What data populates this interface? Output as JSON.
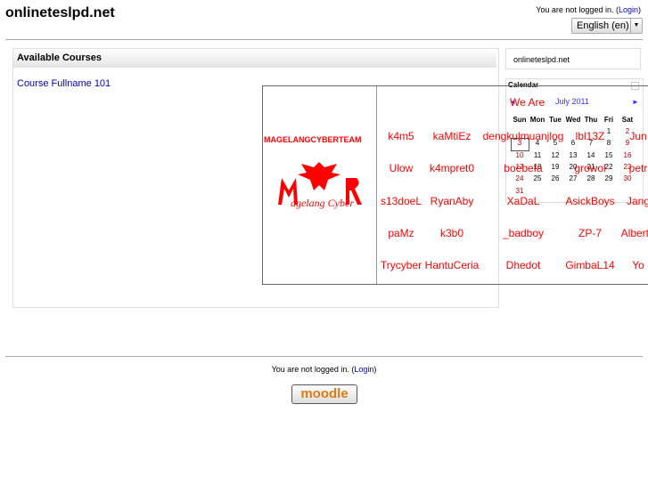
{
  "header": {
    "site_title": "onlineteslpd.net",
    "login_text": "You are not logged in. (",
    "login_link": "Login",
    "login_close": ")",
    "language": "English (en)"
  },
  "main": {
    "block_title": "Available Courses",
    "course": "Course Fullname 101"
  },
  "sidebar": {
    "site_name": "onlineteslpd.net",
    "calendar": {
      "title": "Calendar",
      "month": "July 2011",
      "prev": "◄",
      "next": "►",
      "days": [
        "Sun",
        "Mon",
        "Tue",
        "Wed",
        "Thu",
        "Fri",
        "Sat"
      ],
      "weeks": [
        [
          "",
          "",
          "",
          "",
          "",
          "1",
          "2"
        ],
        [
          "3",
          "4",
          "5",
          "6",
          "7",
          "8",
          "9"
        ],
        [
          "10",
          "11",
          "12",
          "13",
          "14",
          "15",
          "16"
        ],
        [
          "17",
          "18",
          "19",
          "20",
          "21",
          "22",
          "23"
        ],
        [
          "24",
          "25",
          "26",
          "27",
          "28",
          "29",
          "30"
        ],
        [
          "31",
          "",
          "",
          "",
          "",
          "",
          ""
        ]
      ],
      "today": "3"
    }
  },
  "overlay": {
    "team": "MAGELANGCYBERTEAM",
    "logo_text": "Magelang Cyber",
    "we_are": "We Are",
    "names": [
      [
        "k4m5",
        "kaMtiEz",
        "dengkulmuanjlog",
        "lbl13Z",
        "Jun"
      ],
      [
        "Ulow",
        "k4mpret0",
        "boebefa",
        "growol",
        "petr"
      ],
      [
        "s13doeL",
        "RyanAby",
        "XaDaL",
        "AsickBoys",
        "Jang"
      ],
      [
        "paMz",
        "k3b0",
        "_badboy",
        "ZP-7",
        "AlbertT"
      ],
      [
        "Trycyber",
        "HantuCeria",
        "Dhedot",
        "GimbaL14",
        "Yo"
      ]
    ]
  },
  "footer": {
    "login_text": "You are not logged in. (",
    "login_link": "Login",
    "login_close": ")",
    "logo": "moodle"
  },
  "colors": {
    "accent": "#0000cc",
    "deface": "#ff0000"
  }
}
